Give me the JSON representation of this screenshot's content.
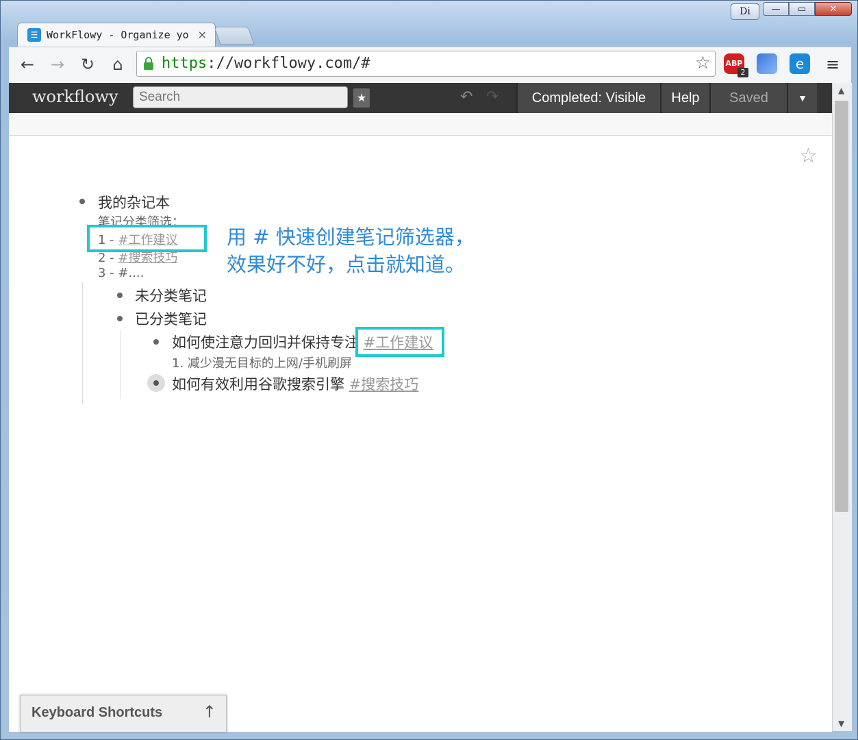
{
  "browser": {
    "tab_title": "WorkFlowy - Organize yo",
    "tab_close": "×",
    "url_scheme": "https",
    "url_rest": "://workflowy.com/#",
    "di_label": "Di",
    "abp_label": "ABP",
    "abp_badge": "2",
    "win_min": "—",
    "win_max": "▭",
    "win_close": "✕"
  },
  "workflowy": {
    "logo": "workflowy",
    "search_placeholder": "Search",
    "completed_label": "Completed: Visible",
    "help_label": "Help",
    "saved_label": "Saved",
    "dropdown_glyph": "▼"
  },
  "outline": {
    "root": {
      "title": "我的杂记本",
      "note_line1": "笔记分类筛选：",
      "note_line2_prefix": "1 - ",
      "note_line2_tag": "#工作建议",
      "note_line3_prefix": "2 - ",
      "note_line3_tag": "#搜索技巧",
      "note_line4": "3 - #...."
    },
    "child1": "未分类笔记",
    "child2": "已分类笔记",
    "grandchild1": {
      "title": "如何使注意力回归并保持专注",
      "tag": "#工作建议",
      "note": "1. 减少漫无目标的上网/手机刷屏"
    },
    "grandchild2": {
      "title": "如何有效利用谷歌搜索引擎",
      "tag": "#搜索技巧"
    }
  },
  "annotation": {
    "line1": "用 # 快速创建笔记筛选器，",
    "line2": "效果好不好，点击就知道。"
  },
  "keyboard_shortcuts": {
    "label": "Keyboard Shortcuts",
    "arrow": "↑"
  },
  "colors": {
    "highlight": "#1ec9cf",
    "annotation": "#2f8ad8",
    "header_bg": "#353535"
  }
}
